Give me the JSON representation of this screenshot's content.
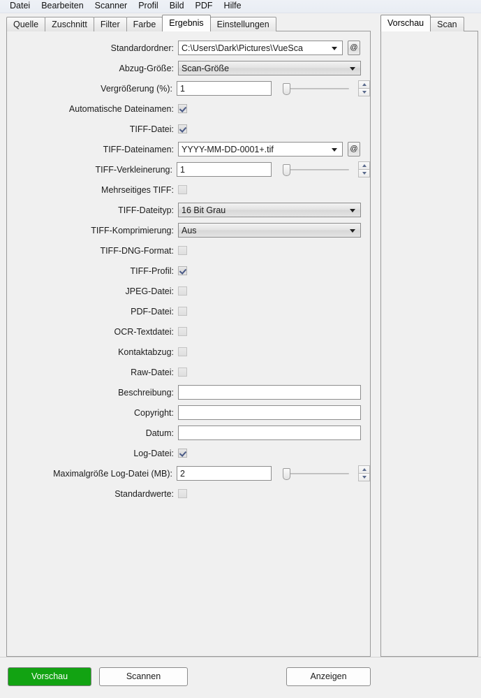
{
  "menubar": {
    "items": [
      {
        "label": "Datei"
      },
      {
        "label": "Bearbeiten"
      },
      {
        "label": "Scanner"
      },
      {
        "label": "Profil"
      },
      {
        "label": "Bild"
      },
      {
        "label": "PDF"
      },
      {
        "label": "Hilfe"
      }
    ]
  },
  "left_tabs": [
    {
      "label": "Quelle",
      "active": false
    },
    {
      "label": "Zuschnitt",
      "active": false
    },
    {
      "label": "Filter",
      "active": false
    },
    {
      "label": "Farbe",
      "active": false
    },
    {
      "label": "Ergebnis",
      "active": true
    },
    {
      "label": "Einstellungen",
      "active": false
    }
  ],
  "right_tabs": [
    {
      "label": "Vorschau",
      "active": true
    },
    {
      "label": "Scan",
      "active": false
    }
  ],
  "form": {
    "standardordner": {
      "label": "Standardordner:",
      "value": "C:\\Users\\Dark\\Pictures\\VueSca",
      "at_button": "@"
    },
    "abzug_groesse": {
      "label": "Abzug-Größe:",
      "value": "Scan-Größe"
    },
    "vergroesserung": {
      "label": "Vergrößerung (%):",
      "value": "1"
    },
    "automatische_dateinamen": {
      "label": "Automatische Dateinamen:",
      "checked": true
    },
    "tiff_datei": {
      "label": "TIFF-Datei:",
      "checked": true
    },
    "tiff_dateinamen": {
      "label": "TIFF-Dateinamen:",
      "value": "YYYY-MM-DD-0001+.tif",
      "at_button": "@"
    },
    "tiff_verkleinerung": {
      "label": "TIFF-Verkleinerung:",
      "value": "1"
    },
    "mehrseitiges_tiff": {
      "label": "Mehrseitiges TIFF:",
      "checked": false
    },
    "tiff_dateityp": {
      "label": "TIFF-Dateityp:",
      "value": "16 Bit Grau"
    },
    "tiff_komprimierung": {
      "label": "TIFF-Komprimierung:",
      "value": "Aus"
    },
    "tiff_dng_format": {
      "label": "TIFF-DNG-Format:",
      "checked": false
    },
    "tiff_profil": {
      "label": "TIFF-Profil:",
      "checked": true
    },
    "jpeg_datei": {
      "label": "JPEG-Datei:",
      "checked": false
    },
    "pdf_datei": {
      "label": "PDF-Datei:",
      "checked": false
    },
    "ocr_textdatei": {
      "label": "OCR-Textdatei:",
      "checked": false
    },
    "kontaktabzug": {
      "label": "Kontaktabzug:",
      "checked": false
    },
    "raw_datei": {
      "label": "Raw-Datei:",
      "checked": false
    },
    "beschreibung": {
      "label": "Beschreibung:",
      "value": ""
    },
    "copyright": {
      "label": "Copyright:",
      "value": ""
    },
    "datum": {
      "label": "Datum:",
      "value": ""
    },
    "log_datei": {
      "label": "Log-Datei:",
      "checked": true
    },
    "maximalgroesse_log": {
      "label": "Maximalgröße Log-Datei (MB):",
      "value": "2"
    },
    "standardwerte": {
      "label": "Standardwerte:",
      "checked": false
    }
  },
  "buttons": {
    "vorschau": "Vorschau",
    "scannen": "Scannen",
    "anzeigen": "Anzeigen"
  },
  "colors": {
    "accent_green": "#12a312",
    "window_bg": "#f0f0f0",
    "menubar_bg": "#eef1f6",
    "border": "#9a9a9a"
  }
}
